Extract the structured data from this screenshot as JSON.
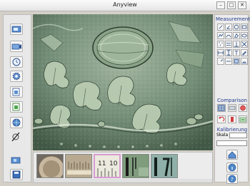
{
  "window": {
    "title": "Anyview",
    "minimize": "–",
    "maximize": "□",
    "close": "✕"
  },
  "left_toolbar": {
    "items": [
      {
        "icon": "snapshot-icon"
      },
      {
        "icon": "record-icon"
      },
      {
        "icon": "timer-icon"
      },
      {
        "icon": "settings-icon"
      },
      {
        "icon": "open-file-icon"
      },
      {
        "icon": "export-icon"
      },
      {
        "icon": "network-icon"
      },
      {
        "icon": "disabled-icon"
      }
    ],
    "bottom": [
      {
        "icon": "camera-source-icon"
      },
      {
        "icon": "save-icon"
      }
    ]
  },
  "thumbnails": {
    "items": [
      {
        "icon": "coin-thumbnail"
      },
      {
        "icon": "ruler-thumbnail-1"
      },
      {
        "icon": "ruler-thumbnail-2",
        "selected": true
      },
      {
        "icon": "ruler-thumbnail-3"
      },
      {
        "icon": "ruler-thumbnail-4"
      }
    ]
  },
  "right_panel": {
    "measurement_title": "Measurement",
    "comparison_title": "Comparison",
    "calibration_title": "Kalibrierung",
    "scale_label": "Skala",
    "scale_value": "",
    "bottom_icons": [
      "home-icon",
      "info-icon",
      "help-icon"
    ]
  },
  "colors": {
    "accent": "#233a8c",
    "thumb_selected": "#d89bd0",
    "window_bg": "#d4d0c8"
  }
}
